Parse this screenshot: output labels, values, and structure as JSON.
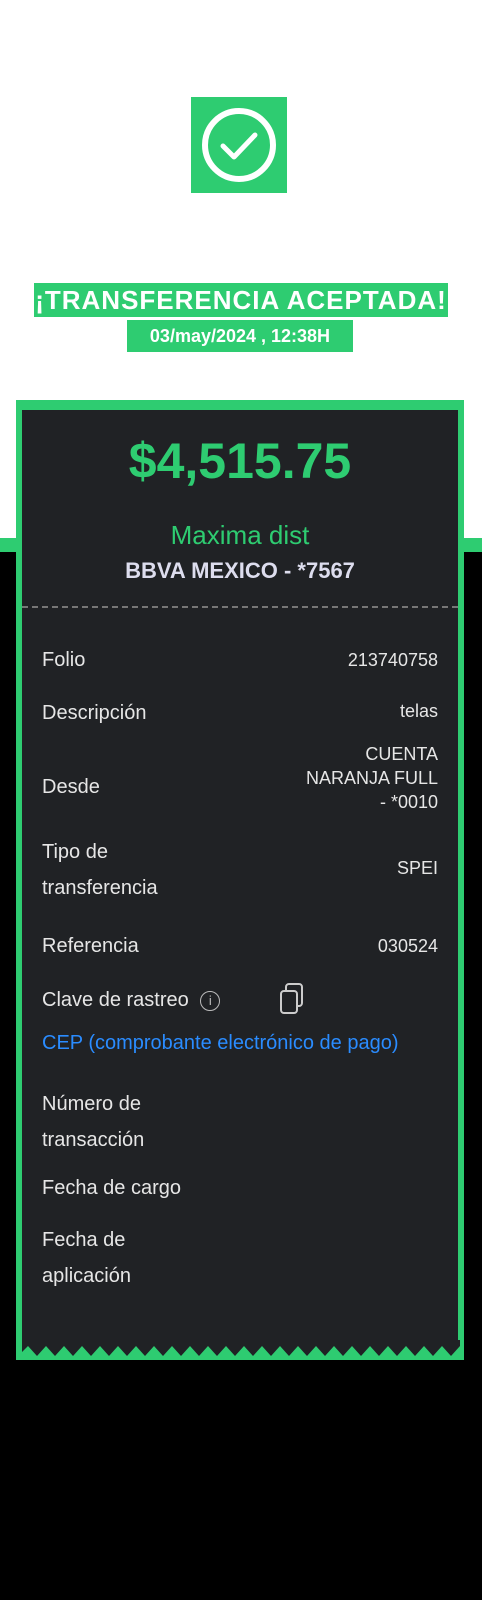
{
  "header": {
    "title": "¡TRANSFERENCIA ACEPTADA!",
    "datetime": "03/may/2024 , 12:38H"
  },
  "receipt": {
    "amount": "$4,515.75",
    "recipient": "Maxima dist",
    "bank": "BBVA MEXICO - *7567",
    "rows": [
      {
        "label": "Folio",
        "value": "213740758"
      },
      {
        "label": "Descripción",
        "value": "telas"
      },
      {
        "label": "Desde",
        "value_lines": [
          "CUENTA",
          "NARANJA FULL",
          "- *0010"
        ]
      },
      {
        "label_lines": [
          "Tipo de",
          "transferencia"
        ],
        "value": "SPEI"
      },
      {
        "label": "Referencia",
        "value": "030524"
      },
      {
        "label": "Clave de rastreo"
      }
    ],
    "cep_link": "CEP (comprobante electrónico de pago)",
    "extra_rows": [
      {
        "label_lines": [
          "Número de",
          "transacción"
        ]
      },
      {
        "label": "Fecha de cargo"
      },
      {
        "label_lines": [
          "Fecha de",
          "aplicación"
        ]
      }
    ]
  },
  "colors": {
    "accent": "#2ecc71",
    "card": "#202225",
    "link": "#2a8cff"
  },
  "icons": [
    "check-circle-icon",
    "info-icon",
    "copy-icon"
  ]
}
